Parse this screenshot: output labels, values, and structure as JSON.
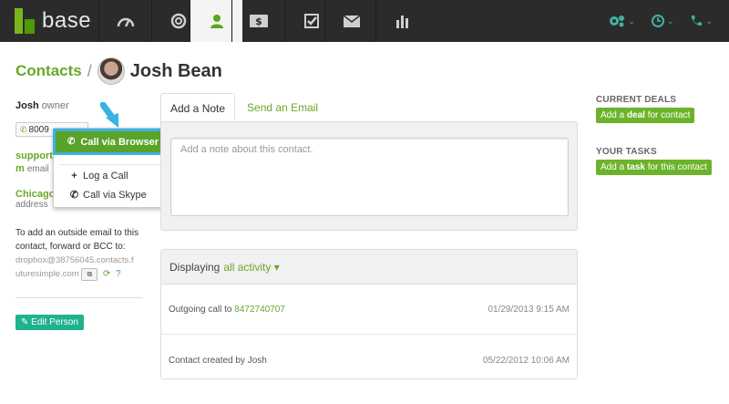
{
  "app": {
    "logo_text": "base"
  },
  "nav": {
    "items": [
      {
        "name": "dashboard",
        "icon": "gauge-icon"
      },
      {
        "name": "leads",
        "icon": "power-icon"
      },
      {
        "name": "contacts",
        "icon": "person-icon",
        "active": true
      },
      {
        "name": "deals",
        "icon": "dollar-icon"
      },
      {
        "name": "tasks",
        "icon": "checkbox-icon"
      },
      {
        "name": "mail",
        "icon": "envelope-icon"
      },
      {
        "name": "reports",
        "icon": "bar-chart-icon"
      }
    ],
    "right": [
      {
        "name": "settings",
        "icon": "gears-icon"
      },
      {
        "name": "time",
        "icon": "clock-icon"
      },
      {
        "name": "phone",
        "icon": "phone-icon"
      }
    ],
    "accent": "#5aa61e",
    "teal": "#3fb39f"
  },
  "breadcrumb": {
    "parent": "Contacts",
    "sep": "/",
    "name": "Josh Bean"
  },
  "left": {
    "owner_name": "Josh",
    "owner_role": "owner",
    "phone_partial": "8009",
    "email_partial_1": "support",
    "email_partial_2": "m",
    "email_label": "email",
    "city": "Chicago",
    "address_label": "address",
    "forward_note": "To add an outside email to this contact, forward or BCC to:",
    "dropbox_1": "dropbox@38756045.contacts.f",
    "dropbox_2": "uturesimple.com",
    "edit_button": "Edit Person"
  },
  "dropdown": {
    "primary": "Call via Browser",
    "items": [
      {
        "icon": "plus-icon",
        "label": "Log a Call"
      },
      {
        "icon": "skype-icon",
        "label": "Call via Skype"
      }
    ]
  },
  "tabs": [
    {
      "label": "Add a Note",
      "active": true
    },
    {
      "label": "Send an Email",
      "active": false
    }
  ],
  "note": {
    "placeholder": "Add a note about this contact."
  },
  "activity": {
    "prefix": "Displaying",
    "filter": "all activity",
    "rows": [
      {
        "text": "Outgoing call to",
        "link": "8472740707",
        "time": "01/29/2013 9:15 AM"
      },
      {
        "text": "Contact created by Josh",
        "link": "",
        "time": "05/22/2012 10:06 AM"
      }
    ]
  },
  "right": {
    "deals_title": "CURRENT DEALS",
    "deals_btn_pre": "Add a ",
    "deals_btn_bold": "deal",
    "deals_btn_post": " for contact",
    "tasks_title": "YOUR TASKS",
    "tasks_btn_pre": "Add a ",
    "tasks_btn_bold": "task",
    "tasks_btn_post": " for this contact"
  }
}
